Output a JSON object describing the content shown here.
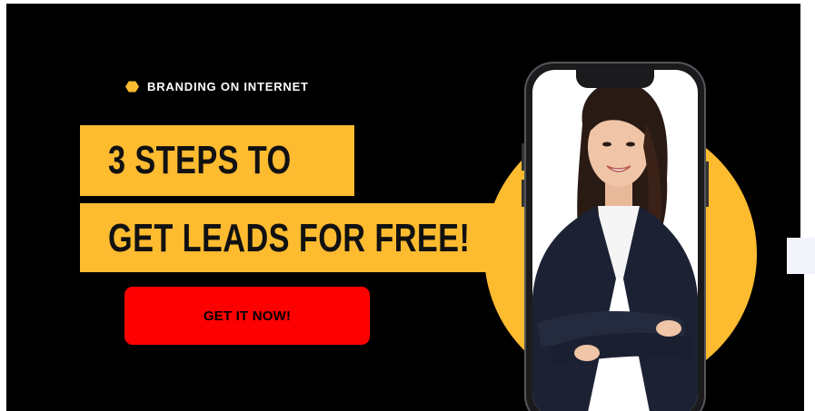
{
  "banner": {
    "eyebrow": "BRANDING ON INTERNET",
    "headline_line1": "3 STEPS TO",
    "headline_line2": "GET LEADS FOR FREE!",
    "cta_label": "GET IT NOW!"
  },
  "colors": {
    "background": "#000000",
    "accent_yellow": "#fdbb30",
    "cta_red": "#ff0000",
    "headline_text": "#111111"
  },
  "icons": {
    "eyebrow_bullet": "hexagon-icon"
  }
}
